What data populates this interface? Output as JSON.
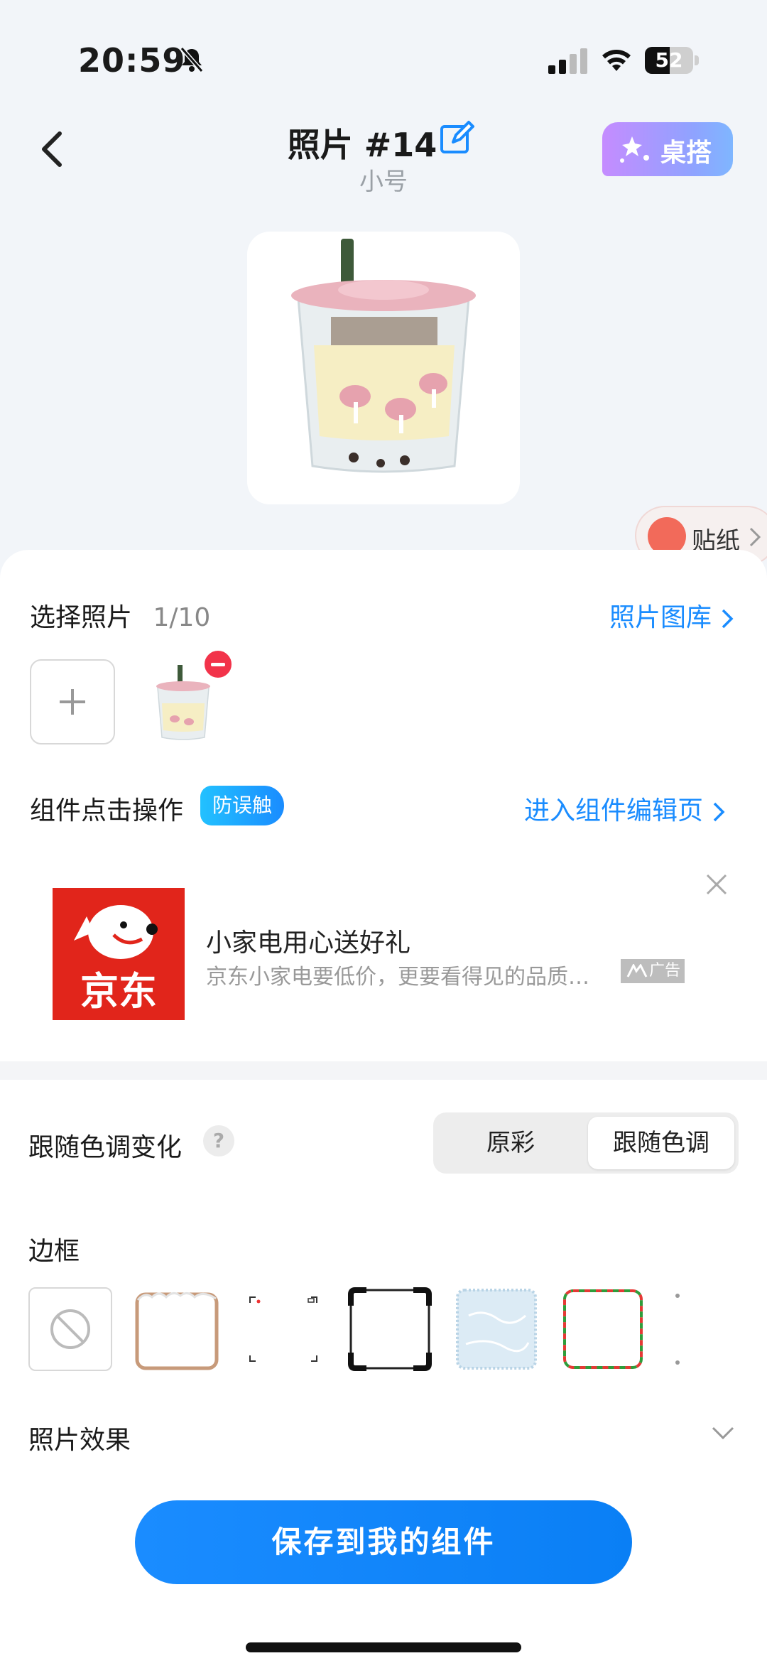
{
  "status_bar": {
    "time": "20:59",
    "battery": "52",
    "battery_level": 0.52
  },
  "header": {
    "title": "照片 #14",
    "subtitle": "小号",
    "desktop_button": "桌搭"
  },
  "sticker_button": {
    "label": "贴纸"
  },
  "select_photos": {
    "label": "选择照片",
    "count": "1/10",
    "gallery_link": "照片图库"
  },
  "click_action": {
    "label": "组件点击操作",
    "badge": "防误触",
    "edit_link": "进入组件编辑页"
  },
  "ad": {
    "brand_logo_text": "京东",
    "title": "小家电用心送好礼",
    "description": "京东小家电要低价，更要看得见的品质…",
    "tag": "广告"
  },
  "follow_tone": {
    "label": "跟随色调变化",
    "help": "?",
    "options": [
      "原彩",
      "跟随色调"
    ],
    "selected": "跟随色调"
  },
  "border": {
    "label": "边框"
  },
  "photo_effect": {
    "label": "照片效果"
  },
  "save_button": {
    "label": "保存到我的组件"
  },
  "colors": {
    "accent": "#1a8cff",
    "danger": "#f2334a",
    "jd_red": "#e1251b"
  }
}
